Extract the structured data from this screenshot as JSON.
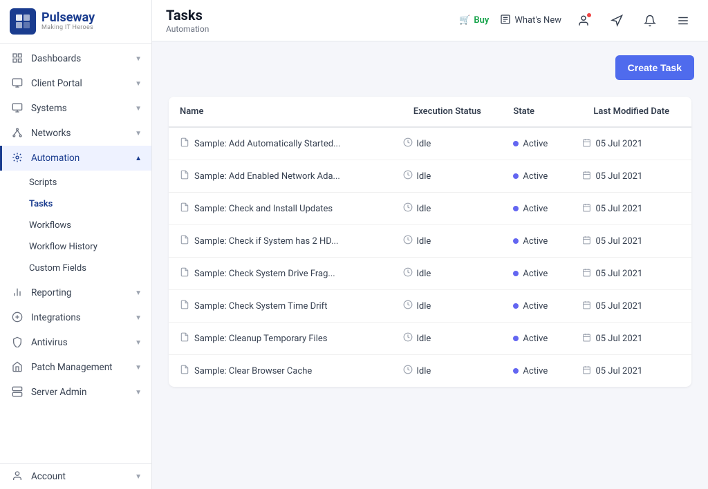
{
  "sidebar": {
    "logo": {
      "main": "Pulseway",
      "sub": "Making IT Heroes"
    },
    "nav_items": [
      {
        "id": "dashboards",
        "label": "Dashboards",
        "icon": "grid",
        "has_children": true,
        "active": false
      },
      {
        "id": "client-portal",
        "label": "Client Portal",
        "icon": "monitor-open",
        "has_children": true,
        "active": false
      },
      {
        "id": "systems",
        "label": "Systems",
        "icon": "monitor",
        "has_children": true,
        "active": false
      },
      {
        "id": "networks",
        "label": "Networks",
        "icon": "network",
        "has_children": true,
        "active": false
      },
      {
        "id": "automation",
        "label": "Automation",
        "icon": "settings",
        "has_children": true,
        "active": true
      },
      {
        "id": "reporting",
        "label": "Reporting",
        "icon": "bar-chart",
        "has_children": true,
        "active": false
      },
      {
        "id": "integrations",
        "label": "Integrations",
        "icon": "puzzle",
        "has_children": true,
        "active": false
      },
      {
        "id": "antivirus",
        "label": "Antivirus",
        "icon": "shield",
        "has_children": true,
        "active": false
      },
      {
        "id": "patch-management",
        "label": "Patch Management",
        "icon": "home",
        "has_children": true,
        "active": false
      },
      {
        "id": "server-admin",
        "label": "Server Admin",
        "icon": "server",
        "has_children": true,
        "active": false
      }
    ],
    "automation_sub": [
      {
        "id": "scripts",
        "label": "Scripts",
        "active": false
      },
      {
        "id": "tasks",
        "label": "Tasks",
        "active": true
      },
      {
        "id": "workflows",
        "label": "Workflows",
        "active": false
      },
      {
        "id": "workflow-history",
        "label": "Workflow History",
        "active": false
      },
      {
        "id": "custom-fields",
        "label": "Custom Fields",
        "active": false
      }
    ],
    "account": {
      "label": "Account"
    }
  },
  "topbar": {
    "title": "Tasks",
    "subtitle": "Automation",
    "buy_label": "Buy",
    "whats_new_label": "What's New"
  },
  "content": {
    "create_task_label": "Create Task",
    "table": {
      "headers": [
        {
          "id": "name",
          "label": "Name"
        },
        {
          "id": "execution-status",
          "label": "Execution Status"
        },
        {
          "id": "state",
          "label": "State"
        },
        {
          "id": "last-modified-date",
          "label": "Last Modified Date"
        }
      ],
      "rows": [
        {
          "name": "Sample: Add Automatically Started...",
          "exec_status": "Idle",
          "state": "Active",
          "date": "05 Jul 2021"
        },
        {
          "name": "Sample: Add Enabled Network Ada...",
          "exec_status": "Idle",
          "state": "Active",
          "date": "05 Jul 2021"
        },
        {
          "name": "Sample: Check and Install Updates",
          "exec_status": "Idle",
          "state": "Active",
          "date": "05 Jul 2021"
        },
        {
          "name": "Sample: Check if System has 2 HD...",
          "exec_status": "Idle",
          "state": "Active",
          "date": "05 Jul 2021"
        },
        {
          "name": "Sample: Check System Drive Frag...",
          "exec_status": "Idle",
          "state": "Active",
          "date": "05 Jul 2021"
        },
        {
          "name": "Sample: Check System Time Drift",
          "exec_status": "Idle",
          "state": "Active",
          "date": "05 Jul 2021"
        },
        {
          "name": "Sample: Cleanup Temporary Files",
          "exec_status": "Idle",
          "state": "Active",
          "date": "05 Jul 2021"
        },
        {
          "name": "Sample: Clear Browser Cache",
          "exec_status": "Idle",
          "state": "Active",
          "date": "05 Jul 2021"
        }
      ]
    }
  }
}
